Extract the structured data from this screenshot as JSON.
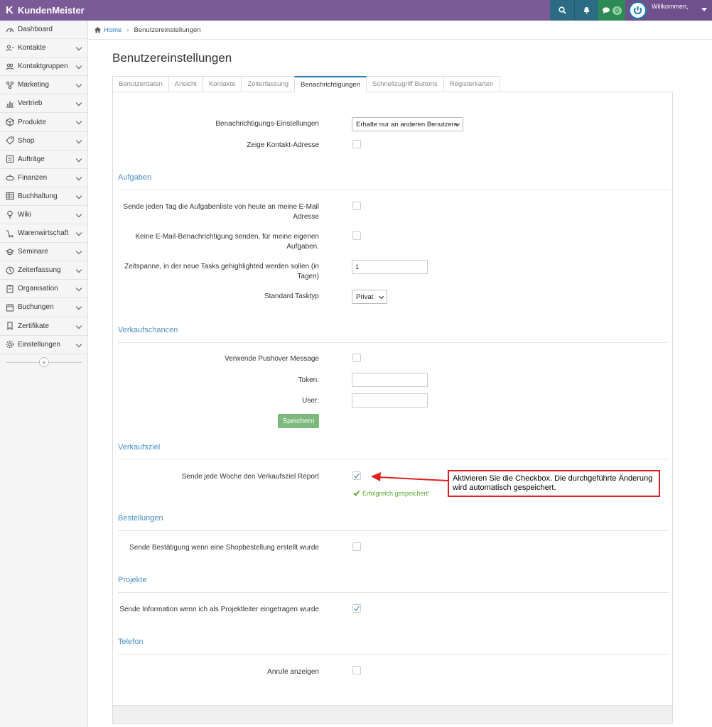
{
  "app": {
    "brand": "KundenMeister",
    "welcome": "Willkommen,",
    "chat_count": "0"
  },
  "sidebar": {
    "items": [
      {
        "label": "Dashboard",
        "icon": "dashboard-icon"
      },
      {
        "label": "Kontakte",
        "icon": "contacts-icon"
      },
      {
        "label": "Kontaktgruppen",
        "icon": "contact-groups-icon"
      },
      {
        "label": "Marketing",
        "icon": "marketing-icon"
      },
      {
        "label": "Vertrieb",
        "icon": "sales-chart-icon"
      },
      {
        "label": "Produkte",
        "icon": "products-box-icon"
      },
      {
        "label": "Shop",
        "icon": "shop-tag-icon"
      },
      {
        "label": "Aufträge",
        "icon": "orders-icon"
      },
      {
        "label": "Finanzen",
        "icon": "finances-icon"
      },
      {
        "label": "Buchhaltung",
        "icon": "accounting-icon"
      },
      {
        "label": "Wiki",
        "icon": "wiki-bulb-icon"
      },
      {
        "label": "Warenwirtschaft",
        "icon": "inventory-icon"
      },
      {
        "label": "Seminare",
        "icon": "seminar-icon"
      },
      {
        "label": "Zeiterfassung",
        "icon": "clock-icon"
      },
      {
        "label": "Organisation",
        "icon": "organisation-icon"
      },
      {
        "label": "Buchungen",
        "icon": "calendar-icon"
      },
      {
        "label": "Zertifikate",
        "icon": "bookmark-icon"
      },
      {
        "label": "Einstellungen",
        "icon": "gear-icon"
      }
    ],
    "collapse_label": "«"
  },
  "breadcrumb": {
    "home": "Home",
    "current": "Benutzereinstellungen"
  },
  "page": {
    "title": "Benutzereinstellungen"
  },
  "tabs": [
    "Benutzerdaten",
    "Ansicht",
    "Kontakte",
    "Zeiterfassung",
    "Benachrichtigungen",
    "Schnellzugriff Buttons",
    "Registerkarten"
  ],
  "active_tab": "Benachrichtigungen",
  "general": {
    "notif_settings_label": "Benachrichtigungs-Einstellungen",
    "notif_settings_value": "Erhalte nur an anderen Benutzern",
    "show_contact_address_label": "Zeige Kontakt-Adresse"
  },
  "aufgaben": {
    "title": "Aufgaben",
    "daily_list_label_1": "Sende jeden Tag die Aufgabenliste von heute an meine E-Mail",
    "daily_list_label_2": "Adresse",
    "no_email_own_label_1": "Keine E-Mail-Benachrichtigung senden, für meine eigenen",
    "no_email_own_label_2": "Aufgaben.",
    "highlight_label_1": "Zeitspanne, in der neue Tasks gehighlighted werden sollen (in",
    "highlight_label_2": "Tagen)",
    "highlight_value": "1",
    "task_type_label": "Standard Tasktyp",
    "task_type_value": "Privat"
  },
  "verkaufschancen": {
    "title": "Verkaufschancen",
    "pushover_label": "Verwende Pushover Message",
    "token_label": "Token:",
    "user_label": "User:",
    "save_label": "Speichern"
  },
  "verkaufsziel": {
    "title": "Verkaufsziel",
    "weekly_report_label": "Sende jede Woche den Verkaufsziel Report",
    "saved_message": "Erfolgreich gespeichert!"
  },
  "bestellungen": {
    "title": "Bestellungen",
    "confirm_label": "Sende Bestätigung wenn eine Shopbestellung erstellt wurde"
  },
  "projekte": {
    "title": "Projekte",
    "leader_label": "Sende Information wenn ich als Projektleiter eingetragen wurde"
  },
  "telefon": {
    "title": "Telefon",
    "calls_label": "Anrufe anzeigen"
  },
  "callout": {
    "text_1": "Aktivieren Sie die Checkbox. Die durchgeführte Änderung",
    "text_2": "wird automatisch gespeichert."
  },
  "colors": {
    "topbar": "#7a5a97",
    "accent": "#2b7bb9",
    "success": "#5aa832",
    "save_button": "#7cb97c",
    "callout_border": "#e02020"
  }
}
